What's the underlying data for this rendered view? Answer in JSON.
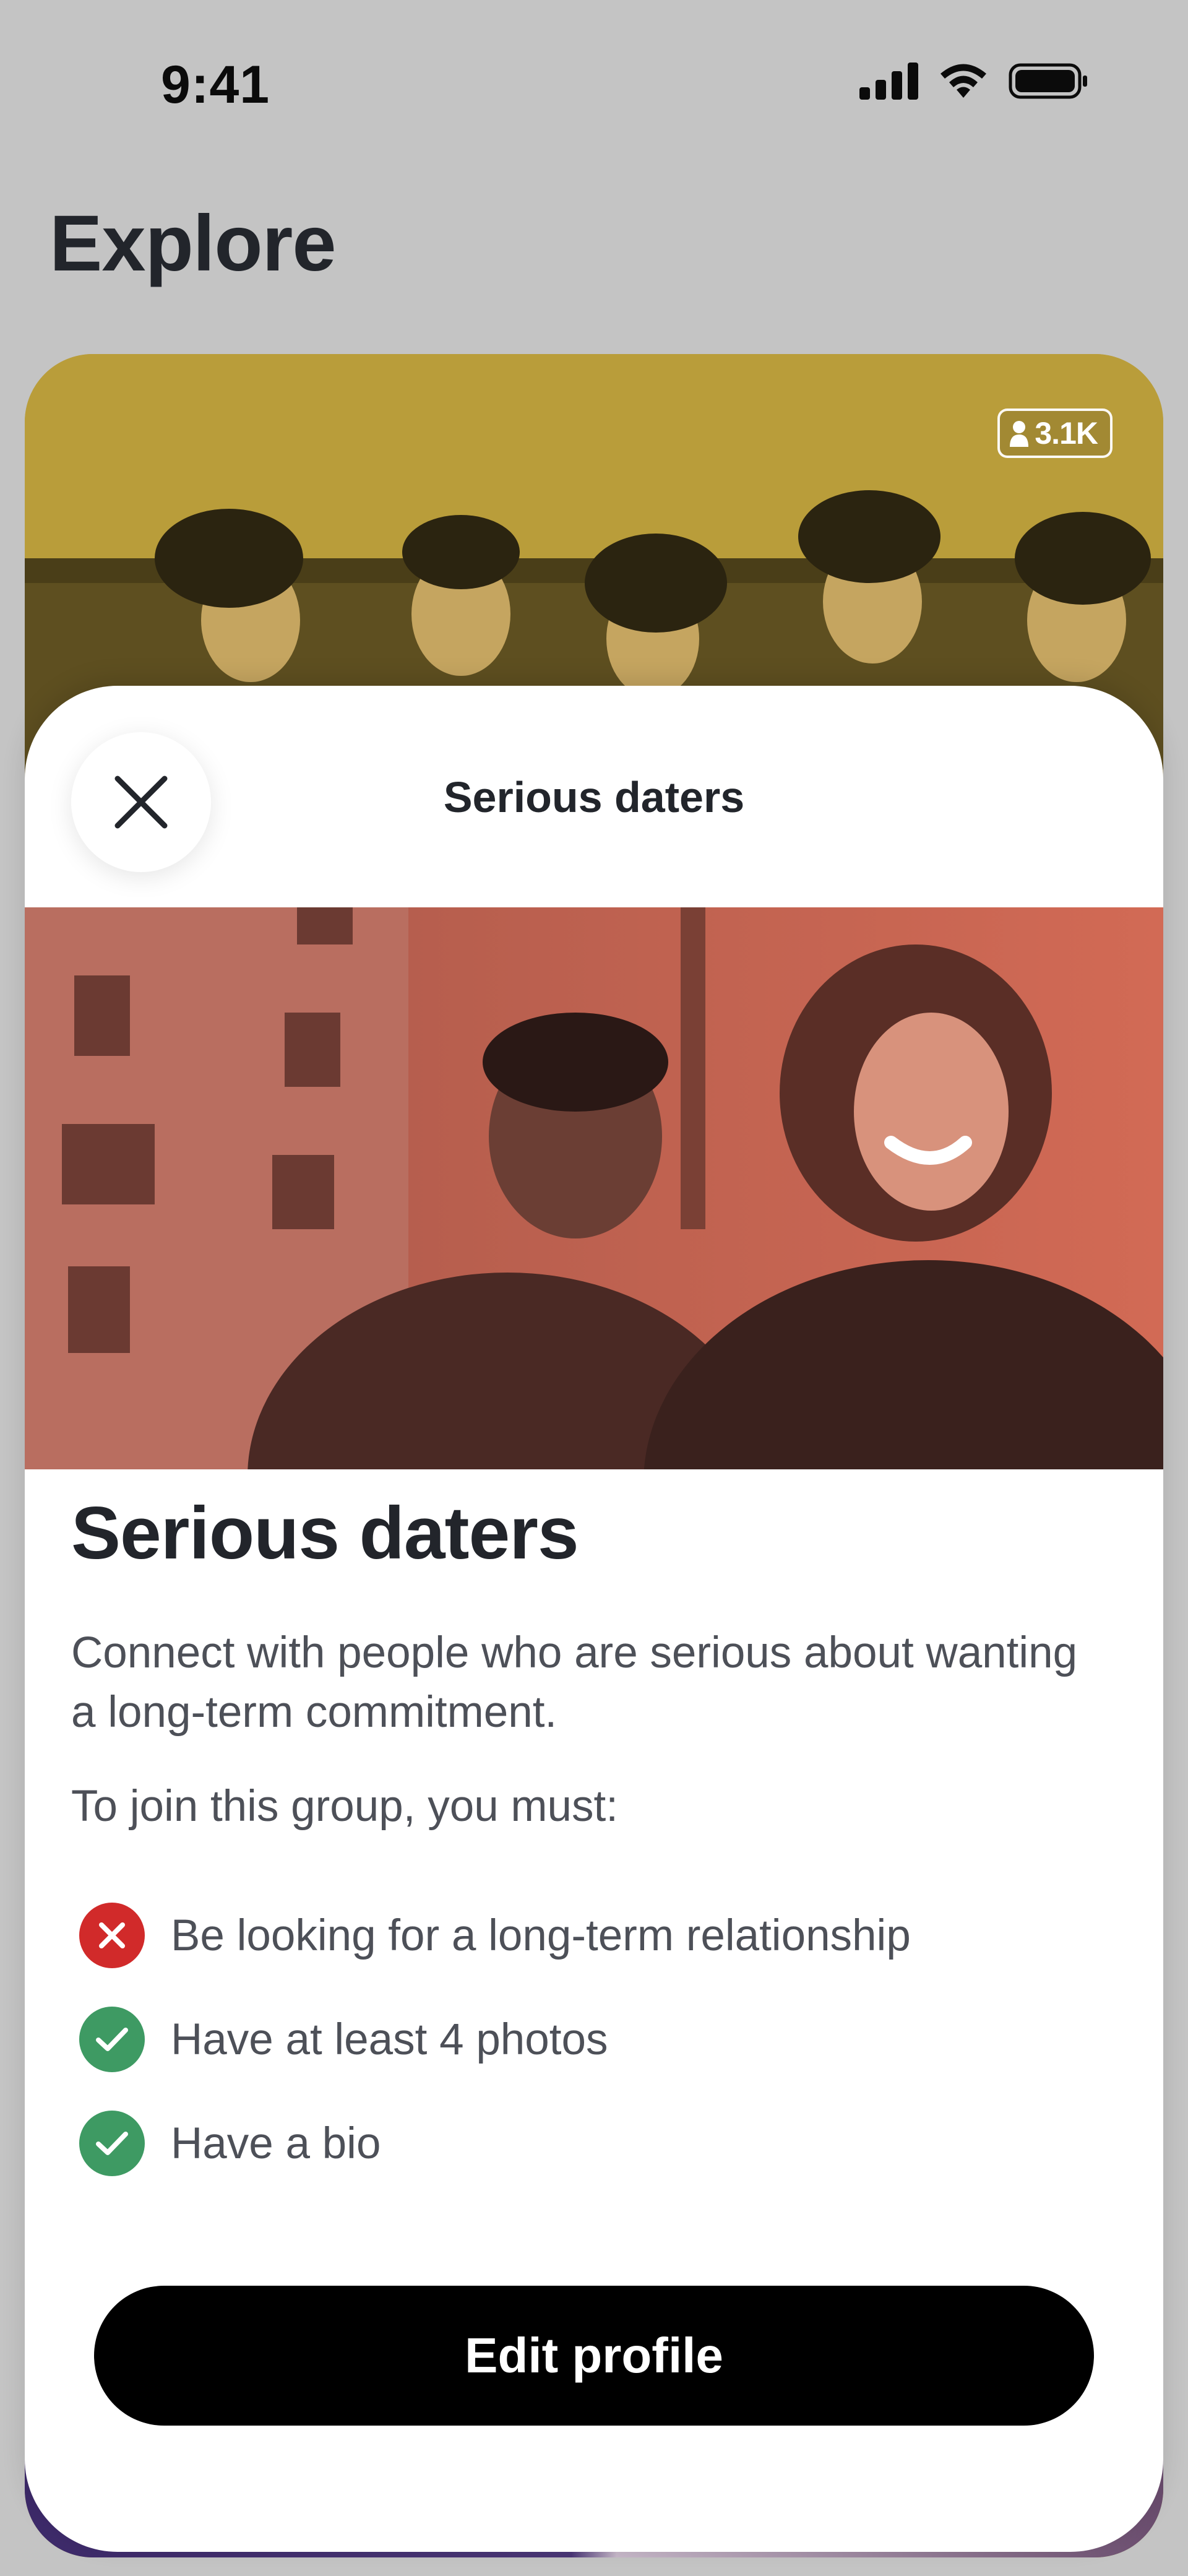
{
  "status_bar": {
    "time": "9:41",
    "icons": [
      "cellular-signal-icon",
      "wifi-icon",
      "battery-icon"
    ]
  },
  "header": {
    "title": "Explore"
  },
  "background_card": {
    "members_count": "3.1K",
    "members_icon": "person-icon",
    "tint_color": "#b99d3a"
  },
  "sheet": {
    "close_icon": "close-icon",
    "title": "Serious daters",
    "hero_tint_color": "#c4543f",
    "heading": "Serious daters",
    "description": "Connect with people who are serious about wanting a long-term commitment.",
    "requirements_intro": "To join this group, you must:",
    "requirements": [
      {
        "text": "Be looking for a long-term relationship",
        "status": "unmet",
        "icon": "x-circle-icon",
        "color": "#d12a2a"
      },
      {
        "text": "Have at least 4 photos",
        "status": "met",
        "icon": "check-circle-icon",
        "color": "#3e9a63"
      },
      {
        "text": "Have a bio",
        "status": "met",
        "icon": "check-circle-icon",
        "color": "#3e9a63"
      }
    ],
    "primary_button": "Edit profile"
  }
}
